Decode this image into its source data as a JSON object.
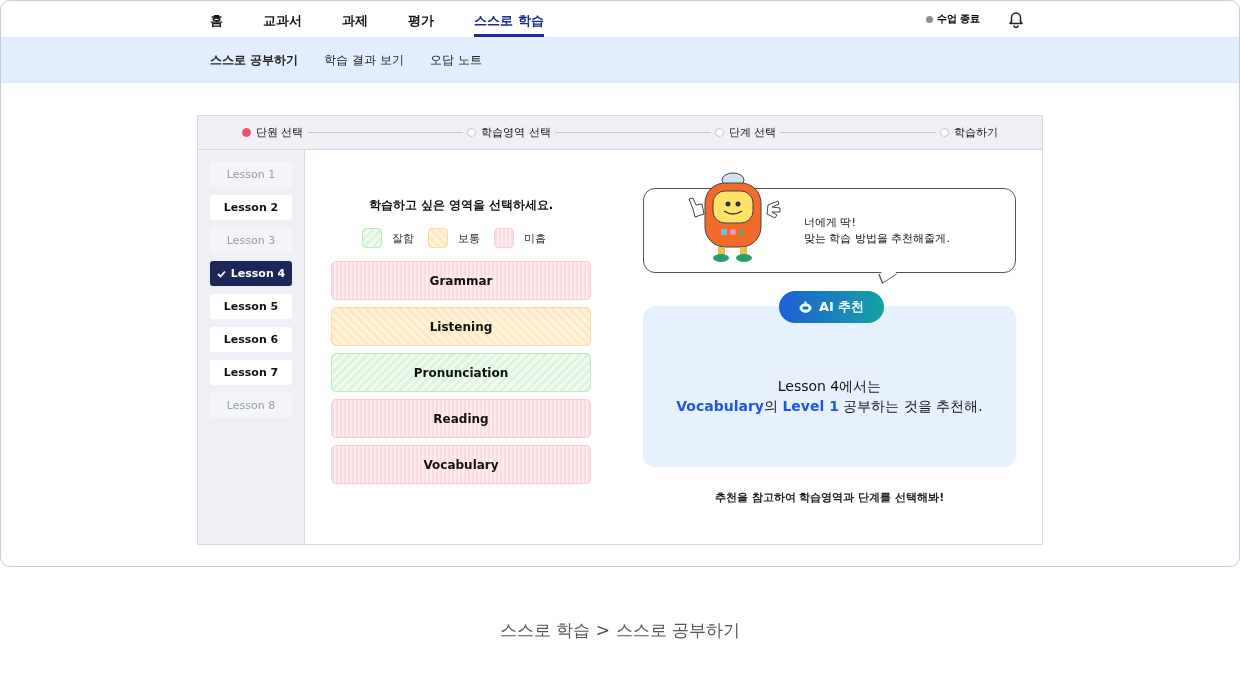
{
  "nav": {
    "items": [
      {
        "label": "홈",
        "selected": false
      },
      {
        "label": "교과서",
        "selected": false
      },
      {
        "label": "과제",
        "selected": false
      },
      {
        "label": "평가",
        "selected": false
      },
      {
        "label": "스스로 학습",
        "selected": true
      }
    ],
    "end_class": "수업 종료"
  },
  "subnav": {
    "items": [
      {
        "label": "스스로 공부하기",
        "selected": true
      },
      {
        "label": "학습 결과 보기",
        "selected": false
      },
      {
        "label": "오답 노트",
        "selected": false
      }
    ]
  },
  "steps": [
    {
      "label": "단원 선택",
      "selected": true
    },
    {
      "label": "학습영역 선택",
      "selected": false
    },
    {
      "label": "단계 선택",
      "selected": false
    },
    {
      "label": "학습하기",
      "selected": false
    }
  ],
  "lessons": [
    {
      "label": "Lesson 1",
      "selected": false,
      "disabled": true
    },
    {
      "label": "Lesson 2",
      "selected": false,
      "disabled": false
    },
    {
      "label": "Lesson 3",
      "selected": false,
      "disabled": true
    },
    {
      "label": "Lesson 4",
      "selected": true,
      "disabled": false
    },
    {
      "label": "Lesson 5",
      "selected": false,
      "disabled": false
    },
    {
      "label": "Lesson 6",
      "selected": false,
      "disabled": false
    },
    {
      "label": "Lesson 7",
      "selected": false,
      "disabled": false
    },
    {
      "label": "Lesson 8",
      "selected": false,
      "disabled": true
    }
  ],
  "area_prompt": "학습하고 싶은 영역을 선택하세요.",
  "legend": [
    {
      "kind": "good",
      "label": "잘함"
    },
    {
      "kind": "normal",
      "label": "보통"
    },
    {
      "kind": "poor",
      "label": "미흡"
    }
  ],
  "areas": [
    {
      "label": "Grammar",
      "kind": "poor"
    },
    {
      "label": "Listening",
      "kind": "normal"
    },
    {
      "label": "Pronunciation",
      "kind": "good"
    },
    {
      "label": "Reading",
      "kind": "poor"
    },
    {
      "label": "Vocabulary",
      "kind": "poor"
    }
  ],
  "speech": [
    "너에게 딱!",
    "맞는 학습 방법을 추천해줄게."
  ],
  "ai_badge": "AI 추천",
  "recommendation": [
    "Lesson 4에서는",
    "**Vocabulary**의 **Level 1** 공부하는 것을 추천해."
  ],
  "hint": "추천을 참고하여 학습영역과 단계를 선택해봐!",
  "caption": "스스로 학습 > 스스로 공부하기"
}
